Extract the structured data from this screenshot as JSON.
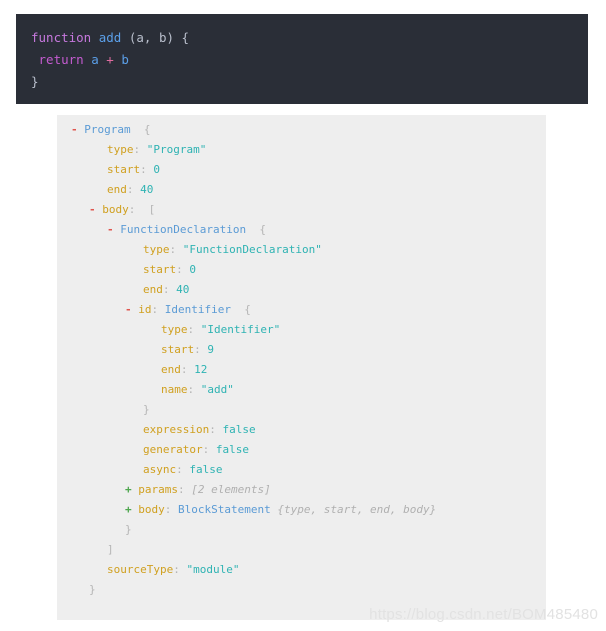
{
  "watermark": "https://blog.csdn.net/BOM485480",
  "colors": {
    "code_background": "#2a2e37",
    "tree_background": "#eeeeee",
    "page_background": "#ffffff",
    "keyword": "#c678dd",
    "function_name": "#5b9fe8",
    "operator": "#e06ca0",
    "node_type": "#5b9bd5",
    "property_key": "#d0a020",
    "value": "#2fb3b3",
    "toggle_collapse": "#e0564f",
    "toggle_expand": "#4ea64e",
    "preview_text": "#b0b0b0",
    "watermark": "#e2e2e2"
  },
  "code": {
    "language": "javascript",
    "lines": [
      [
        {
          "t": "function",
          "c": "tok-kw"
        },
        {
          "t": " ",
          "c": "tok-punc"
        },
        {
          "t": "add",
          "c": "tok-fn"
        },
        {
          "t": " (a, b) {",
          "c": "tok-punc"
        }
      ],
      [
        {
          "t": " ",
          "c": "tok-punc"
        },
        {
          "t": "return",
          "c": "tok-kw2"
        },
        {
          "t": " ",
          "c": "tok-punc"
        },
        {
          "t": "a",
          "c": "tok-var"
        },
        {
          "t": " ",
          "c": "tok-punc"
        },
        {
          "t": "+",
          "c": "tok-op"
        },
        {
          "t": " ",
          "c": "tok-punc"
        },
        {
          "t": "b",
          "c": "tok-var"
        }
      ],
      [
        {
          "t": "}",
          "c": "tok-punc"
        }
      ]
    ],
    "plain_text": "function add (a, b) {\n return a + b\n}"
  },
  "tree": {
    "lines": [
      {
        "indent": 0,
        "toggle": "-",
        "parts": [
          {
            "t": "Program",
            "c": "n-type"
          },
          {
            "t": "  {",
            "c": "n-punc"
          }
        ]
      },
      {
        "indent": 2,
        "toggle": "",
        "parts": [
          {
            "t": "type",
            "c": "n-key"
          },
          {
            "t": ": ",
            "c": "n-punc"
          },
          {
            "t": "\"Program\"",
            "c": "n-val"
          }
        ]
      },
      {
        "indent": 2,
        "toggle": "",
        "parts": [
          {
            "t": "start",
            "c": "n-key"
          },
          {
            "t": ": ",
            "c": "n-punc"
          },
          {
            "t": "0",
            "c": "n-val"
          }
        ]
      },
      {
        "indent": 2,
        "toggle": "",
        "parts": [
          {
            "t": "end",
            "c": "n-key"
          },
          {
            "t": ": ",
            "c": "n-punc"
          },
          {
            "t": "40",
            "c": "n-val"
          }
        ]
      },
      {
        "indent": 1,
        "toggle": "-",
        "parts": [
          {
            "t": "body",
            "c": "n-key"
          },
          {
            "t": ":  [",
            "c": "n-punc"
          }
        ]
      },
      {
        "indent": 2,
        "toggle": "-",
        "parts": [
          {
            "t": "FunctionDeclaration",
            "c": "n-type"
          },
          {
            "t": "  {",
            "c": "n-punc"
          }
        ]
      },
      {
        "indent": 4,
        "toggle": "",
        "parts": [
          {
            "t": "type",
            "c": "n-key"
          },
          {
            "t": ": ",
            "c": "n-punc"
          },
          {
            "t": "\"FunctionDeclaration\"",
            "c": "n-val"
          }
        ]
      },
      {
        "indent": 4,
        "toggle": "",
        "parts": [
          {
            "t": "start",
            "c": "n-key"
          },
          {
            "t": ": ",
            "c": "n-punc"
          },
          {
            "t": "0",
            "c": "n-val"
          }
        ]
      },
      {
        "indent": 4,
        "toggle": "",
        "parts": [
          {
            "t": "end",
            "c": "n-key"
          },
          {
            "t": ": ",
            "c": "n-punc"
          },
          {
            "t": "40",
            "c": "n-val"
          }
        ]
      },
      {
        "indent": 3,
        "toggle": "-",
        "parts": [
          {
            "t": "id",
            "c": "n-key"
          },
          {
            "t": ": ",
            "c": "n-punc"
          },
          {
            "t": "Identifier",
            "c": "n-type"
          },
          {
            "t": "  {",
            "c": "n-punc"
          }
        ]
      },
      {
        "indent": 5,
        "toggle": "",
        "parts": [
          {
            "t": "type",
            "c": "n-key"
          },
          {
            "t": ": ",
            "c": "n-punc"
          },
          {
            "t": "\"Identifier\"",
            "c": "n-val"
          }
        ]
      },
      {
        "indent": 5,
        "toggle": "",
        "parts": [
          {
            "t": "start",
            "c": "n-key"
          },
          {
            "t": ": ",
            "c": "n-punc"
          },
          {
            "t": "9",
            "c": "n-val"
          }
        ]
      },
      {
        "indent": 5,
        "toggle": "",
        "parts": [
          {
            "t": "end",
            "c": "n-key"
          },
          {
            "t": ": ",
            "c": "n-punc"
          },
          {
            "t": "12",
            "c": "n-val"
          }
        ]
      },
      {
        "indent": 5,
        "toggle": "",
        "parts": [
          {
            "t": "name",
            "c": "n-key"
          },
          {
            "t": ": ",
            "c": "n-punc"
          },
          {
            "t": "\"add\"",
            "c": "n-val"
          }
        ]
      },
      {
        "indent": 4,
        "toggle": "",
        "parts": [
          {
            "t": "}",
            "c": "n-punc"
          }
        ]
      },
      {
        "indent": 4,
        "toggle": "",
        "parts": [
          {
            "t": "expression",
            "c": "n-key"
          },
          {
            "t": ": ",
            "c": "n-punc"
          },
          {
            "t": "false",
            "c": "n-val"
          }
        ]
      },
      {
        "indent": 4,
        "toggle": "",
        "parts": [
          {
            "t": "generator",
            "c": "n-key"
          },
          {
            "t": ": ",
            "c": "n-punc"
          },
          {
            "t": "false",
            "c": "n-val"
          }
        ]
      },
      {
        "indent": 4,
        "toggle": "",
        "parts": [
          {
            "t": "async",
            "c": "n-key"
          },
          {
            "t": ": ",
            "c": "n-punc"
          },
          {
            "t": "false",
            "c": "n-val"
          }
        ]
      },
      {
        "indent": 3,
        "toggle": "+",
        "parts": [
          {
            "t": "params",
            "c": "n-key"
          },
          {
            "t": ": ",
            "c": "n-punc"
          },
          {
            "t": "[2 elements]",
            "c": "n-prev"
          }
        ]
      },
      {
        "indent": 3,
        "toggle": "+",
        "parts": [
          {
            "t": "body",
            "c": "n-key"
          },
          {
            "t": ": ",
            "c": "n-punc"
          },
          {
            "t": "BlockStatement",
            "c": "n-type"
          },
          {
            "t": " ",
            "c": "n-punc"
          },
          {
            "t": "{type, start, end, body}",
            "c": "n-prev"
          }
        ]
      },
      {
        "indent": 3,
        "toggle": "",
        "parts": [
          {
            "t": "}",
            "c": "n-punc"
          }
        ]
      },
      {
        "indent": 2,
        "toggle": "",
        "parts": [
          {
            "t": "]",
            "c": "n-punc"
          }
        ]
      },
      {
        "indent": 2,
        "toggle": "",
        "parts": [
          {
            "t": "sourceType",
            "c": "n-key"
          },
          {
            "t": ": ",
            "c": "n-punc"
          },
          {
            "t": "\"module\"",
            "c": "n-val"
          }
        ]
      },
      {
        "indent": 1,
        "toggle": "",
        "parts": [
          {
            "t": "}",
            "c": "n-punc"
          }
        ]
      }
    ]
  }
}
